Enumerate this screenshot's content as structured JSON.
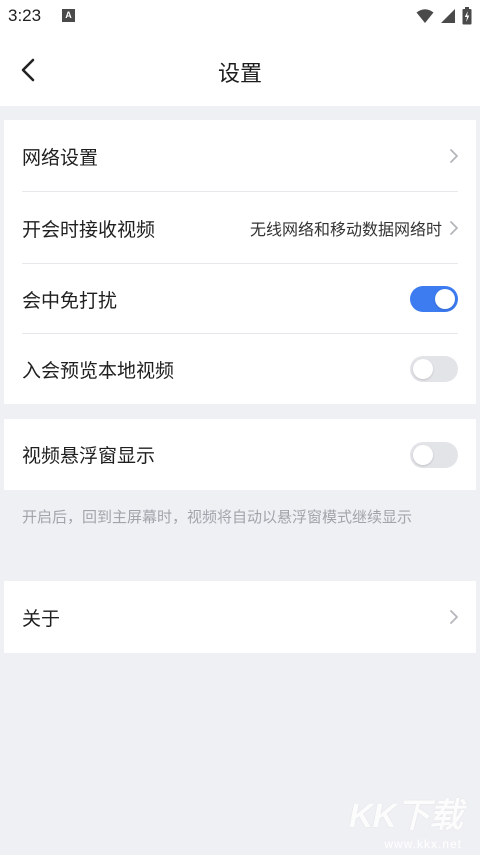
{
  "status_bar": {
    "time": "3:23",
    "app_icon_letter": "A",
    "icons": [
      "wifi-icon",
      "signal-icon",
      "battery-charging-icon"
    ]
  },
  "header": {
    "title": "设置",
    "back_icon": "chevron-left-icon"
  },
  "group1": {
    "network_settings_label": "网络设置",
    "receive_video_label": "开会时接收视频",
    "receive_video_value": "无线网络和移动数据网络时",
    "dnd_label": "会中免打扰",
    "dnd_on": true,
    "preview_label": "入会预览本地视频",
    "preview_on": false
  },
  "group2": {
    "float_window_label": "视频悬浮窗显示",
    "float_window_on": false,
    "hint": "开启后，回到主屏幕时，视频将自动以悬浮窗模式继续显示"
  },
  "group3": {
    "about_label": "关于"
  },
  "watermark": {
    "logo": "KK下载",
    "url": "www.kkx.net"
  },
  "colors": {
    "accent": "#3c7bf0",
    "background": "#eff0f4",
    "toggle_off": "#e3e4e8",
    "hint_text": "#a2a4ab"
  }
}
